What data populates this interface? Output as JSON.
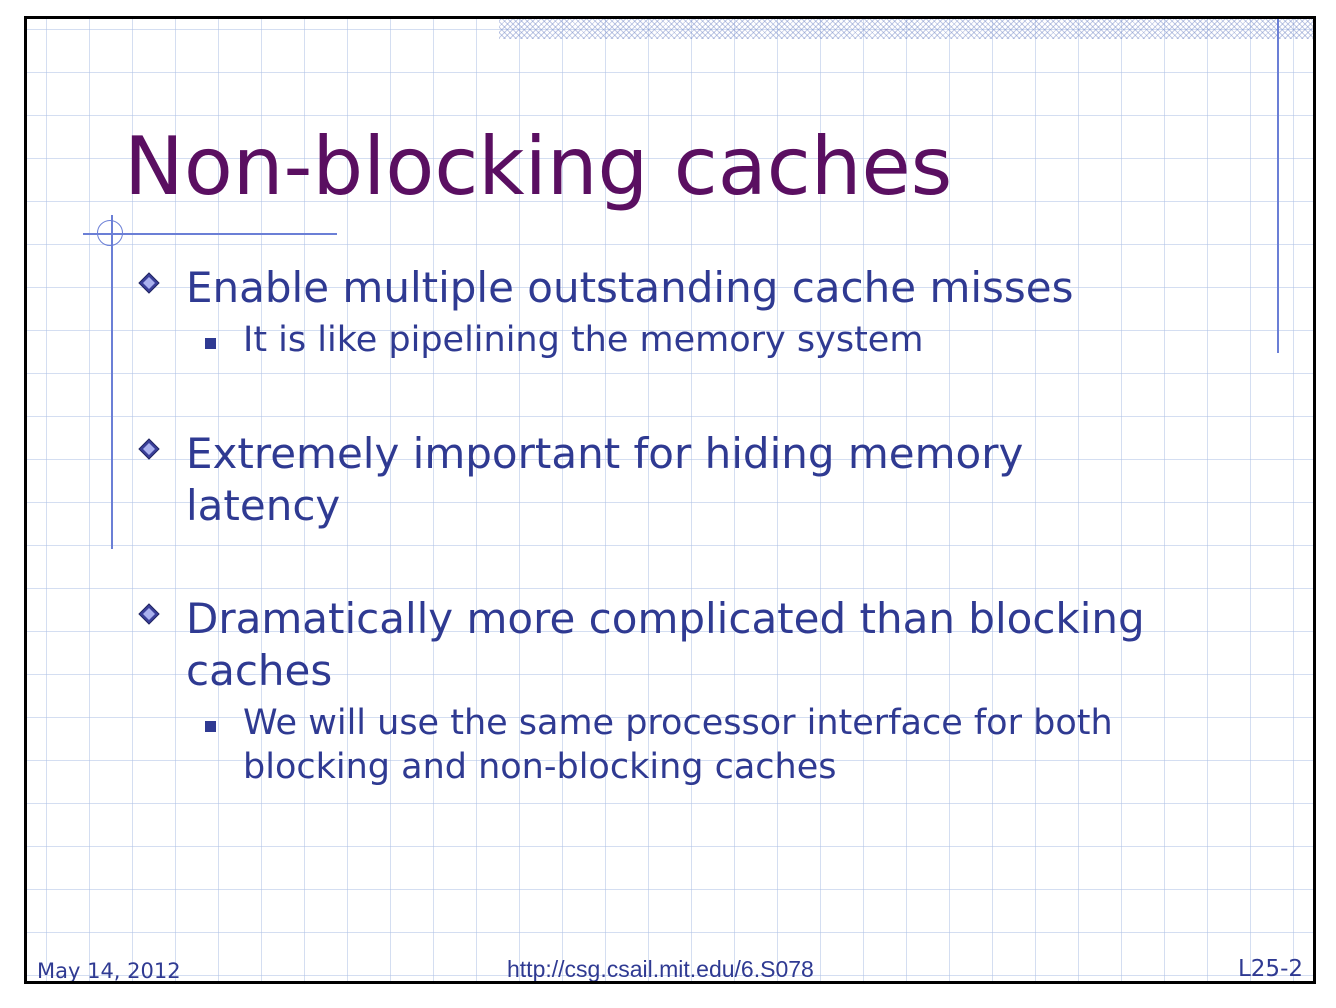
{
  "slide": {
    "title": "Non-blocking caches",
    "bullets": [
      {
        "text": "Enable multiple outstanding cache misses",
        "subs": [
          "It is like pipelining the memory system"
        ]
      },
      {
        "text": "Extremely important for hiding memory latency",
        "subs": []
      },
      {
        "text": "Dramatically more complicated than blocking caches",
        "subs": [
          "We will use the same processor interface for both blocking and non-blocking caches"
        ]
      }
    ]
  },
  "footer": {
    "date": "May 14, 2012",
    "url": "http://csg.csail.mit.edu/6.S078",
    "page": "L25-2"
  },
  "colors": {
    "title": "#5a0f61",
    "text": "#2f3a92",
    "accent_lines": "#6b7fd6",
    "grid": "#b0c2e6"
  },
  "icons": {
    "bullet_level1": "diamond-bullet-icon",
    "bullet_level2": "square-bullet-icon"
  }
}
